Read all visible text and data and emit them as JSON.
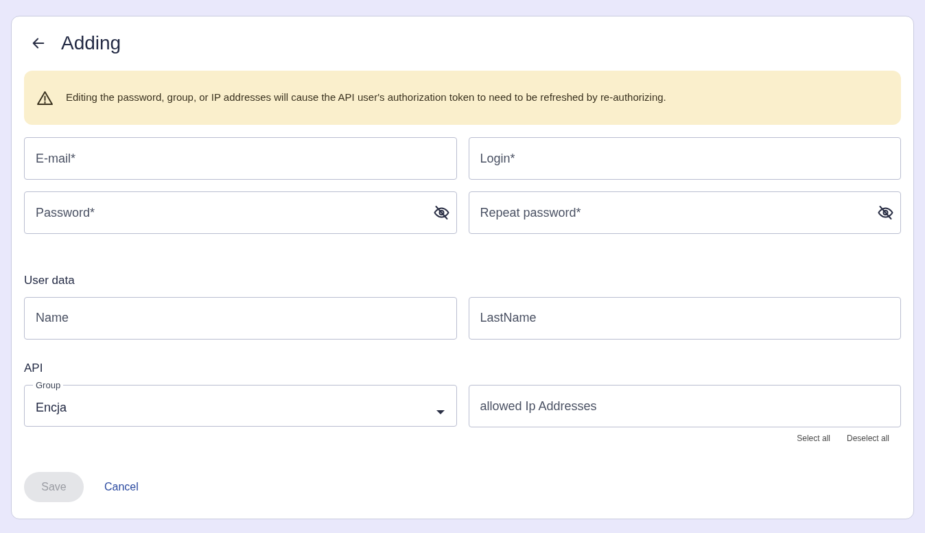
{
  "header": {
    "title": "Adding"
  },
  "alert": {
    "text": "Editing the password, group, or IP addresses will cause the API user's authorization token to need to be refreshed by re-authorizing."
  },
  "credentials": {
    "fields": [
      {
        "kind": "text",
        "placeholder": "E-mail*"
      },
      {
        "kind": "text",
        "placeholder": "Login*"
      },
      {
        "kind": "password",
        "placeholder": "Password*"
      },
      {
        "kind": "password",
        "placeholder": "Repeat password*"
      }
    ]
  },
  "user_data": {
    "heading": "User data",
    "fields": [
      {
        "kind": "text",
        "placeholder": "Name"
      },
      {
        "kind": "text",
        "placeholder": "LastName"
      }
    ]
  },
  "api": {
    "heading": "API",
    "fields": [
      {
        "kind": "select",
        "label": "Group",
        "value": "Encja"
      },
      {
        "kind": "text",
        "placeholder": "allowed Ip Addresses"
      }
    ],
    "links": [
      "Select all",
      "Deselect all"
    ]
  },
  "actions": [
    {
      "kind": "primary",
      "label": "Save",
      "disabled": true
    },
    {
      "kind": "link",
      "label": "Cancel",
      "disabled": false
    }
  ]
}
